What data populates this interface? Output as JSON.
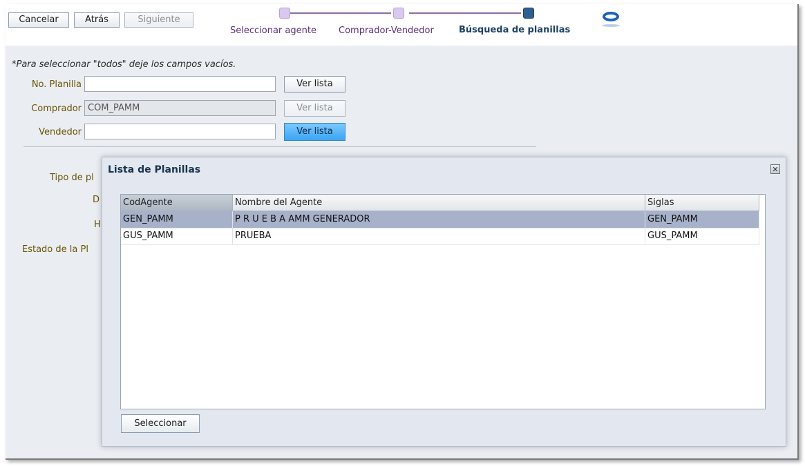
{
  "toolbar": {
    "cancel_label": "Cancelar",
    "back_label": "Atrás",
    "next_label": "Siguiente"
  },
  "train": {
    "steps": [
      {
        "label": "Seleccionar agente"
      },
      {
        "label": "Comprador-Vendedor"
      },
      {
        "label": "Búsqueda de planillas"
      }
    ],
    "current_step": 3
  },
  "form": {
    "hint": "*Para seleccionar \"todos\" deje los campos vacíos.",
    "planilla_label": "No. Planilla",
    "planilla_value": "",
    "comprador_label": "Comprador",
    "comprador_value": "COM_PAMM",
    "vendedor_label": "Vendedor",
    "vendedor_value": "",
    "ver_lista_label": "Ver lista",
    "tipo_label_visible": "Tipo de pl",
    "desde_label_visible": "D",
    "hasta_label_visible": "H",
    "estado_label_visible": "Estado de la Pl"
  },
  "dialog": {
    "title": "Lista de Planillas",
    "close_glyph": "✕",
    "columns": [
      "CodAgente",
      "Nombre del Agente",
      "Siglas"
    ],
    "rows": [
      {
        "cod": "GEN_PAMM",
        "nombre": "P R U E B A AMM GENERADOR",
        "siglas": "GEN_PAMM"
      },
      {
        "cod": "GUS_PAMM",
        "nombre": "PRUEBA",
        "siglas": "GUS_PAMM"
      }
    ],
    "select_label": "Seleccionar"
  },
  "colors": {
    "train_visited": "#d9c8ef",
    "train_current": "#2f5f8f",
    "row_selected": "#a7b1c9",
    "active_button": "#3aa5f2"
  }
}
